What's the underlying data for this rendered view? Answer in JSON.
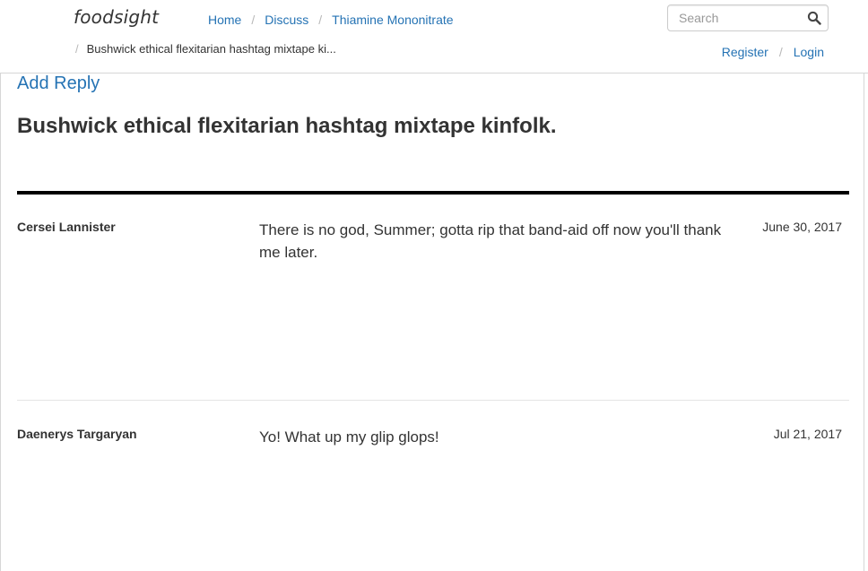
{
  "header": {
    "logo": "foodsight",
    "breadcrumbs": [
      {
        "label": "Home"
      },
      {
        "label": "Discuss"
      },
      {
        "label": "Thiamine Mononitrate"
      }
    ],
    "current_crumb": "Bushwick ethical flexitarian hashtag mixtape ki...",
    "separator": "/",
    "search": {
      "placeholder": "Search",
      "value": ""
    },
    "auth": {
      "register": "Register",
      "login": "Login"
    }
  },
  "topic": {
    "add_reply_label": "Add Reply",
    "title": "Bushwick ethical flexitarian hashtag mixtape kinfolk."
  },
  "posts": [
    {
      "author": "Cersei Lannister",
      "body": "There is no god, Summer; gotta rip that band-aid off now you'll thank me later.",
      "date": "June 30, 2017"
    },
    {
      "author": "Daenerys Targaryan",
      "body": "Yo! What up my glip glops!",
      "date": "Jul 21, 2017"
    }
  ],
  "colors": {
    "link": "#2573b4",
    "text": "#333333",
    "rule": "#000000"
  }
}
